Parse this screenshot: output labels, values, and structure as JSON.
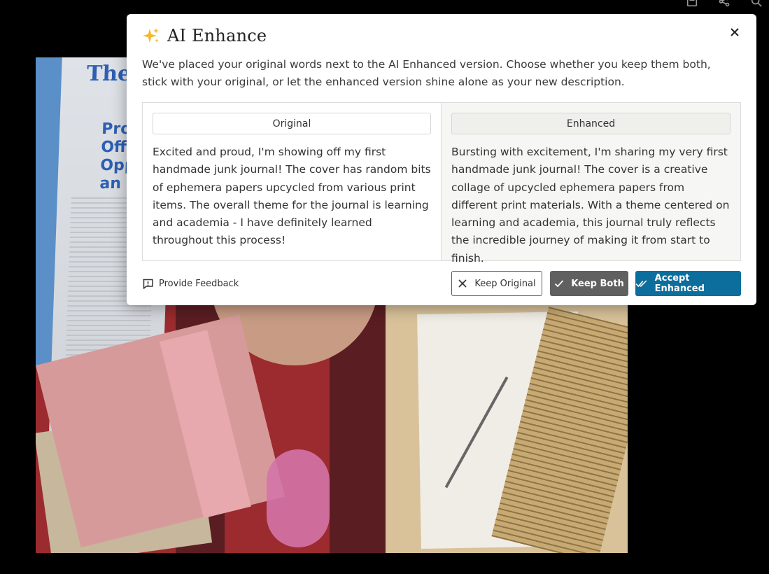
{
  "modal": {
    "title": "AI Enhance",
    "intro": "We've placed your original words next to the AI Enhanced version. Choose whether you keep them both, stick with your original, or let the enhanced version shine alone as your new description.",
    "original": {
      "label": "Original",
      "text": "Excited and proud, I'm showing off my first handmade junk journal! The cover has random bits of ephemera papers upcycled from various print items. The overall theme for the journal is learning and academia - I have definitely learned throughout this process!"
    },
    "enhanced": {
      "label": "Enhanced",
      "text": "Bursting with excitement, I'm sharing my very first handmade junk journal! The cover is a creative collage of upcycled ephemera papers from different print materials. With a theme centered on learning and academia, this journal truly reflects the incredible journey of making it from start to finish."
    },
    "feedback_label": "Provide Feedback",
    "buttons": {
      "keep_original": "Keep Original",
      "keep_both": "Keep Both",
      "accept_enhanced": "Accept Enhanced"
    }
  },
  "background": {
    "news_masthead": "The",
    "news_headline": "Pro\nOffer\nOpp\nan"
  },
  "colors": {
    "accent": "#0c6e9c",
    "secondary_button": "#606060",
    "backdrop": "#000000"
  },
  "icons": {
    "title": "sparkle-icon",
    "close": "close-icon",
    "feedback": "feedback-icon",
    "keep_original": "x-icon",
    "keep_both": "check-icon",
    "accept_enhanced": "double-check-icon",
    "toolbar": [
      "save-icon",
      "share-icon",
      "search-icon"
    ]
  }
}
